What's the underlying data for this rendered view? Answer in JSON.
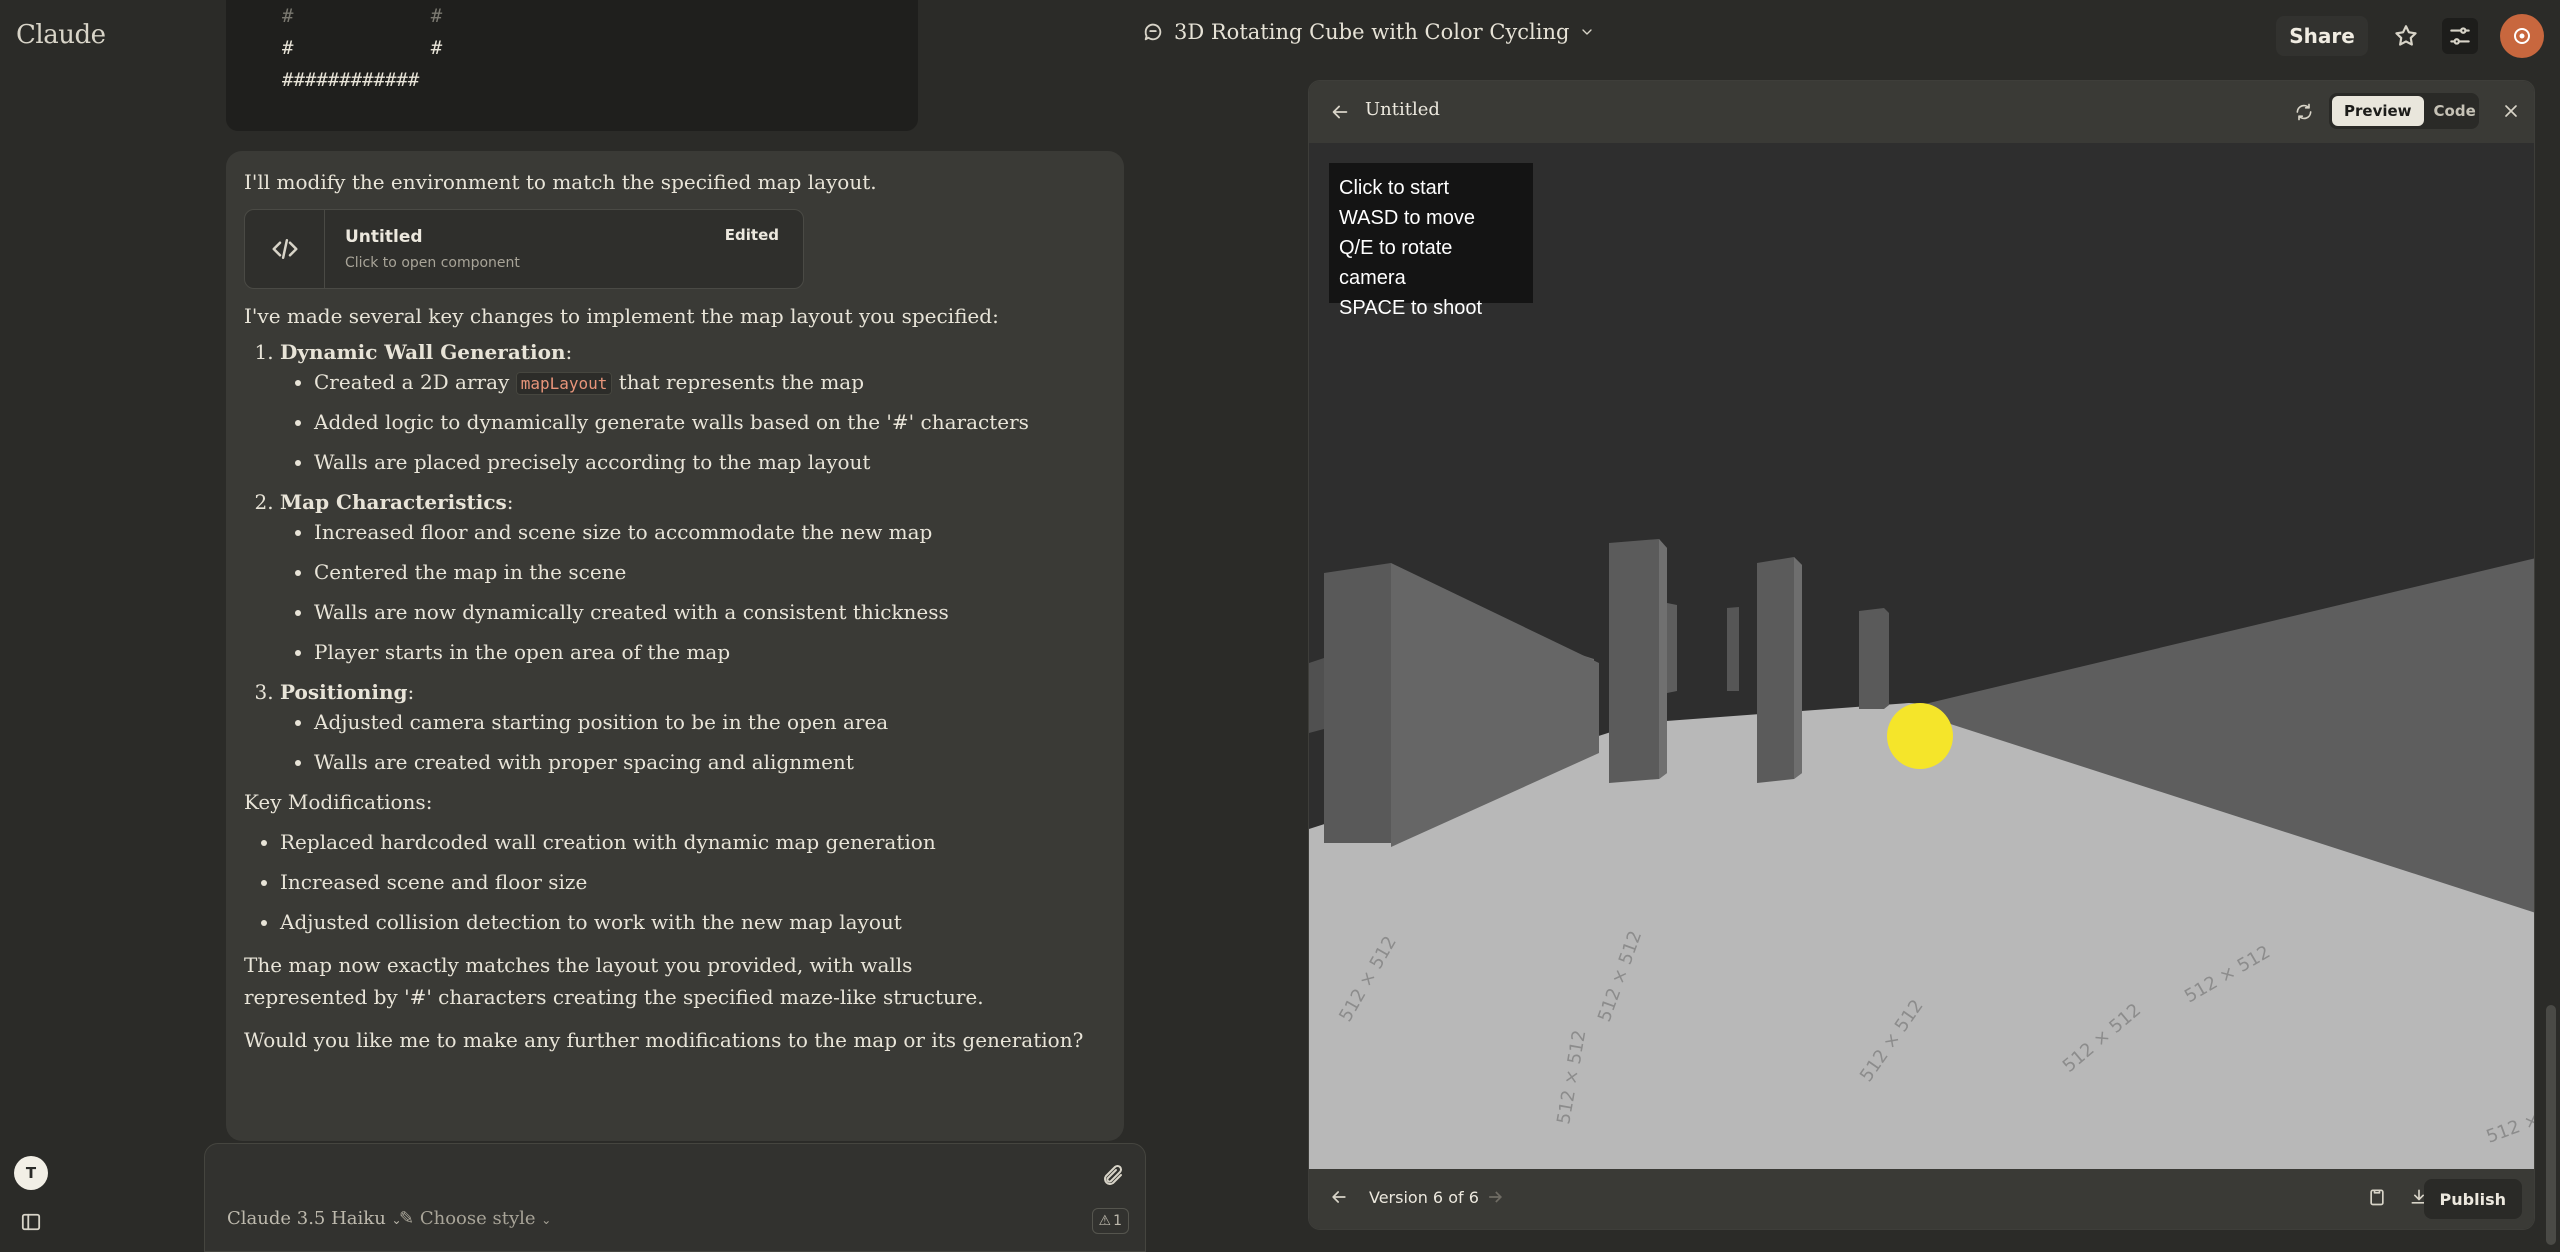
{
  "app": {
    "logo": "Claude",
    "conversation_title": "3D Rotating Cube with Color Cycling",
    "share_label": "Share"
  },
  "code_fragment": {
    "lines": [
      "#            #",
      "#            #",
      "############"
    ]
  },
  "message": {
    "intro": "I'll modify the environment to match the specified map layout.",
    "artifact_card": {
      "title": "Untitled",
      "subtitle": "Click to open component",
      "badge": "Edited"
    },
    "summary": "I've made several key changes to implement the map layout you specified:",
    "sections": [
      {
        "title": "Dynamic Wall Generation",
        "items": [
          {
            "before": "Created a 2D array ",
            "code": "mapLayout",
            "after": " that represents the map"
          },
          {
            "text": "Added logic to dynamically generate walls based on the '#' characters"
          },
          {
            "text": "Walls are placed precisely according to the map layout"
          }
        ]
      },
      {
        "title": "Map Characteristics",
        "items": [
          {
            "text": "Increased floor and scene size to accommodate the new map"
          },
          {
            "text": "Centered the map in the scene"
          },
          {
            "text": "Walls are now dynamically created with a consistent thickness"
          },
          {
            "text": "Player starts in the open area of the map"
          }
        ]
      },
      {
        "title": "Positioning",
        "items": [
          {
            "text": "Adjusted camera starting position to be in the open area"
          },
          {
            "text": "Walls are created with proper spacing and alignment"
          }
        ]
      }
    ],
    "key_mods_heading": "Key Modifications:",
    "key_mods": [
      "Replaced hardcoded wall creation with dynamic map generation",
      "Increased scene and floor size",
      "Adjusted collision detection to work with the new map layout"
    ],
    "closing": "The map now exactly matches the layout you provided, with walls represented by '#' characters creating the specified maze-like structure.",
    "question": "Would you like me to make any further modifications to the map or its generation?"
  },
  "input": {
    "model_label": "Claude 3.5 Haiku",
    "style_label": "Choose style",
    "counter": "1"
  },
  "user": {
    "initial": "T"
  },
  "artifact_panel": {
    "title": "Untitled",
    "tabs": [
      "Preview",
      "Code"
    ],
    "active_tab": "Preview",
    "hud_lines": [
      "Click to start",
      "WASD to move",
      "Q/E to rotate camera",
      "SPACE to shoot"
    ],
    "floor_texture_labels": [
      "512 × 512"
    ],
    "version_label": "Version 6 of 6",
    "publish_label": "Publish"
  },
  "colors": {
    "background": "#2b2b28",
    "message_bg": "#3a3a36",
    "accent": "#c8673e",
    "target": "#f5e52a"
  }
}
